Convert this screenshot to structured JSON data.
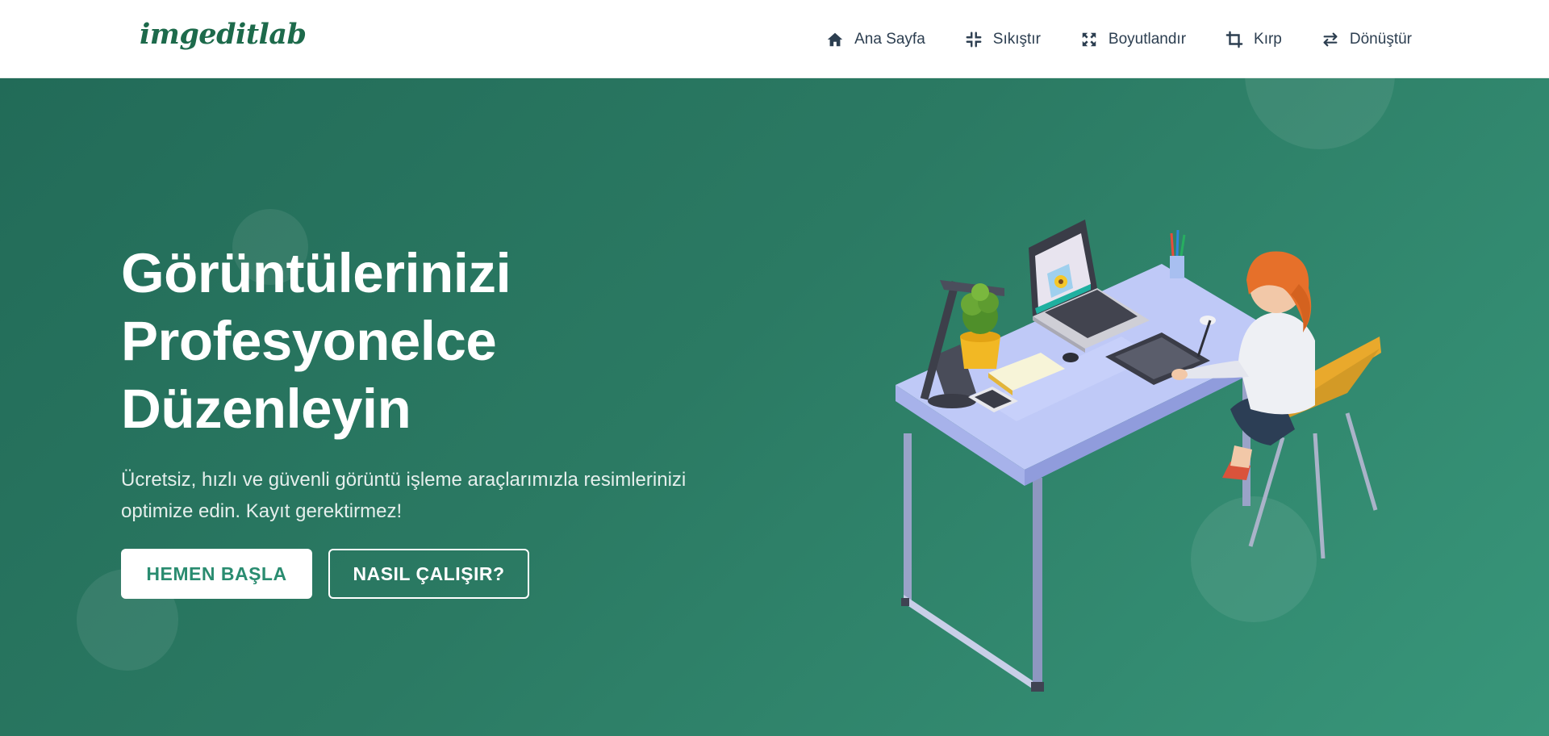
{
  "brand": {
    "logo_text": "imgeditlab"
  },
  "nav": {
    "items": [
      {
        "label": "Ana Sayfa",
        "icon": "home-icon"
      },
      {
        "label": "Sıkıştır",
        "icon": "compress-icon"
      },
      {
        "label": "Boyutlandır",
        "icon": "resize-icon"
      },
      {
        "label": "Kırp",
        "icon": "crop-icon"
      },
      {
        "label": "Dönüştür",
        "icon": "convert-icon"
      }
    ]
  },
  "hero": {
    "title_lines": [
      "Görüntülerinizi",
      "Profesyonelce",
      "Düzenleyin"
    ],
    "subtitle": "Ücretsiz, hızlı ve güvenli görüntü işleme araçlarımızla resimlerinizi optimize edin. Kayıt gerektirmez!",
    "primary_button": "HEMEN BAŞLA",
    "secondary_button": "NASIL ÇALIŞIR?"
  },
  "colors": {
    "brand_green": "#1d6a4b",
    "hero_gradient_start": "#226b58",
    "hero_gradient_end": "#38967a",
    "primary_button_text": "#2a8c70",
    "nav_text": "#2c3e50"
  }
}
